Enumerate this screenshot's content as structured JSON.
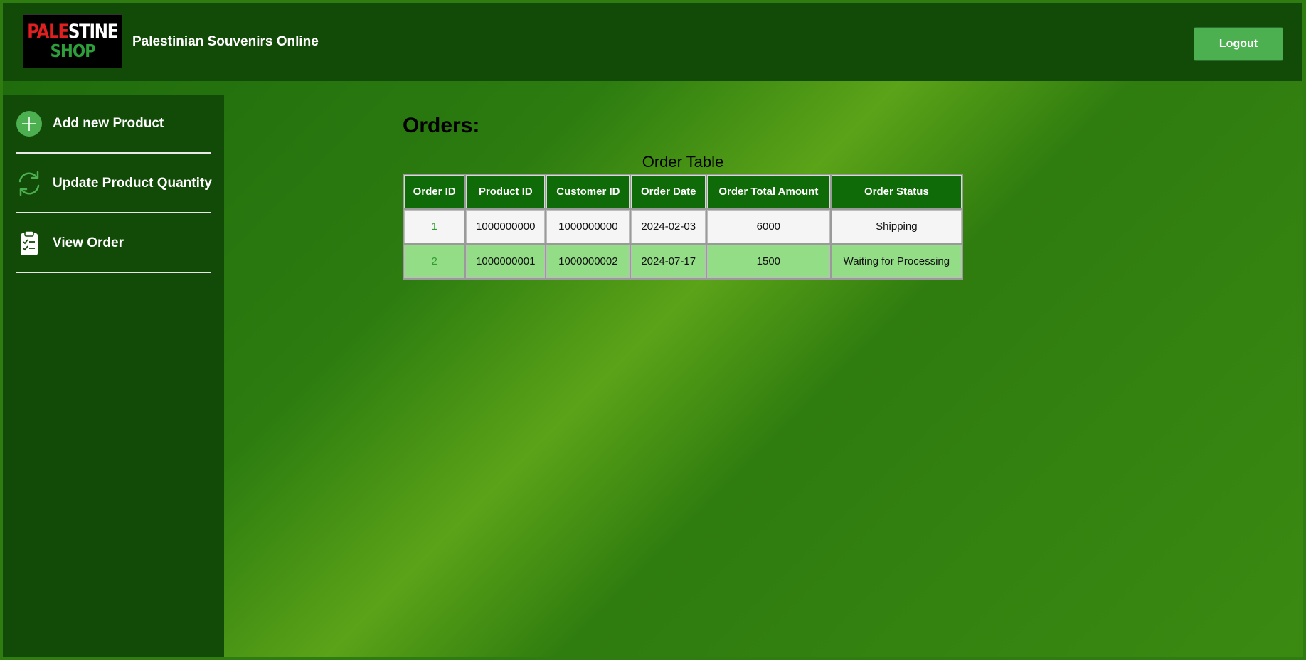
{
  "header": {
    "logo": {
      "line1_part1": "PALE",
      "line1_part2": "STINE",
      "line2": "SHOP"
    },
    "title": "Palestinian Souvenirs Online",
    "logout_label": "Logout"
  },
  "sidebar": {
    "items": [
      {
        "label": "Add new Product",
        "icon": "plus-circle-icon"
      },
      {
        "label": "Update Product Quantity",
        "icon": "refresh-icon"
      },
      {
        "label": "View Order",
        "icon": "clipboard-check-icon"
      }
    ]
  },
  "main": {
    "heading": "Orders:",
    "table_caption": "Order Table",
    "columns": [
      "Order ID",
      "Product ID",
      "Customer ID",
      "Order Date",
      "Order Total Amount",
      "Order Status"
    ],
    "rows": [
      [
        "1",
        "1000000000",
        "1000000000",
        "2024-02-03",
        "6000",
        "Shipping"
      ],
      [
        "2",
        "1000000001",
        "1000000002",
        "2024-07-17",
        "1500",
        "Waiting for Processing"
      ]
    ]
  },
  "colors": {
    "header_bg": "#124a07",
    "sidebar_bg": "#124a07",
    "table_header_bg": "#0f6a08",
    "row_alt_bg": "#94dd87",
    "logout_bg": "#4caf50",
    "logo_red": "#e02020",
    "logo_green": "#2e9e3a"
  }
}
